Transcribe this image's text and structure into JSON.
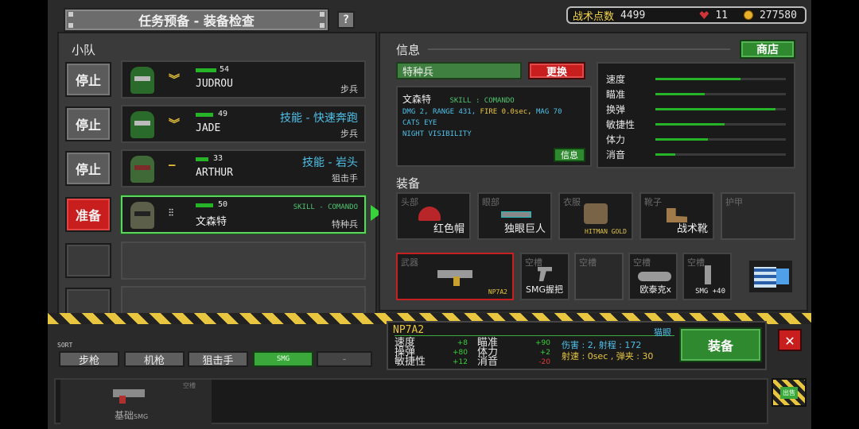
{
  "header": {
    "title": "任务预备 - 装备检查",
    "help_label": "?",
    "tactical_points_label": "战术点数",
    "tactical_points_value": "4499",
    "hearts": "11",
    "gold": "277580"
  },
  "squad": {
    "label": "小队",
    "rows": [
      {
        "button": "停止",
        "button_state": "stop",
        "rank_icon": "double-chevron",
        "level": "54",
        "name": "JUDROU",
        "skill": "",
        "class": "步兵"
      },
      {
        "button": "停止",
        "button_state": "stop",
        "rank_icon": "double-chevron",
        "level": "49",
        "name": "JADE",
        "skill": "技能 - 快速奔跑",
        "class": "步兵"
      },
      {
        "button": "停止",
        "button_state": "stop",
        "rank_icon": "single-bar",
        "level": "33",
        "name": "ARTHUR",
        "skill": "技能 - 岩头",
        "class": "狙击手"
      },
      {
        "button": "准备",
        "button_state": "ready",
        "rank_icon": "double-dot",
        "level": "50",
        "name": "文森特",
        "skill": "SKILL - COMANDO",
        "class": "特种兵"
      }
    ]
  },
  "info": {
    "label": "信息",
    "shop_label": "商店",
    "class_name": "特种兵",
    "change_label": "更换",
    "detail": {
      "name": "文森特",
      "skill": "SKILL : COMANDO",
      "dmg": "DMG 2, ",
      "range": "RANGE 431, ",
      "fire": "FIRE 0.0sec, ",
      "mag": "MAG 70",
      "trait1": "CATS EYE",
      "trait2": "NIGHT VISIBILITY",
      "info_button": "信息"
    },
    "stats": [
      {
        "name": "速度",
        "fill": 0.65
      },
      {
        "name": "瞄准",
        "fill": 0.38
      },
      {
        "name": "换弹",
        "fill": 0.92
      },
      {
        "name": "敏捷性",
        "fill": 0.53
      },
      {
        "name": "体力",
        "fill": 0.4
      },
      {
        "name": "消音",
        "fill": 0.15
      }
    ]
  },
  "equipment": {
    "label": "装备",
    "gear": [
      {
        "category": "头部",
        "name": "红色帽"
      },
      {
        "category": "眼部",
        "name": "独眼巨人"
      },
      {
        "category": "衣服",
        "name": "HITMAN GOLD"
      },
      {
        "category": "靴子",
        "name": "战术靴"
      },
      {
        "category": "护甲",
        "name": ""
      }
    ],
    "weapons": [
      {
        "category": "武器",
        "name": "NP7A2"
      },
      {
        "category": "空槽",
        "name": "SMG握把"
      },
      {
        "category": "空槽",
        "name": ""
      },
      {
        "category": "空槽",
        "name": "欧泰克x"
      },
      {
        "category": "空槽",
        "name": "SMG +40"
      }
    ]
  },
  "weapon_detail": {
    "name": "NP7A2",
    "tag": "猫眼",
    "col1": [
      {
        "name": "速度",
        "value": "+8"
      },
      {
        "name": "操弹",
        "value": "+80"
      },
      {
        "name": "敏捷性",
        "value": "+12"
      }
    ],
    "col2": [
      {
        "name": "瞄准",
        "value": "+90"
      },
      {
        "name": "体力",
        "value": "+2"
      },
      {
        "name": "消音",
        "value": "-20"
      }
    ],
    "damage_line": "伤害 : 2, 射程 : 172",
    "fire_line": "射速 : 0sec , 弹夹 : 30",
    "equip_label": "装备",
    "close_label": "✕"
  },
  "sort": {
    "label": "SORT",
    "buttons": [
      "步枪",
      "机枪",
      "狙击手",
      "SMG",
      "-"
    ]
  },
  "inventory": {
    "items": [
      {
        "name": "基础",
        "sub": "SMG",
        "corner": "空槽"
      }
    ],
    "sell_label": "出售"
  },
  "colors": {
    "accent_green": "#2f8a2f",
    "accent_red": "#c81e1e",
    "highlight_cyan": "#4fc0e8",
    "gold": "#e9b02c"
  }
}
